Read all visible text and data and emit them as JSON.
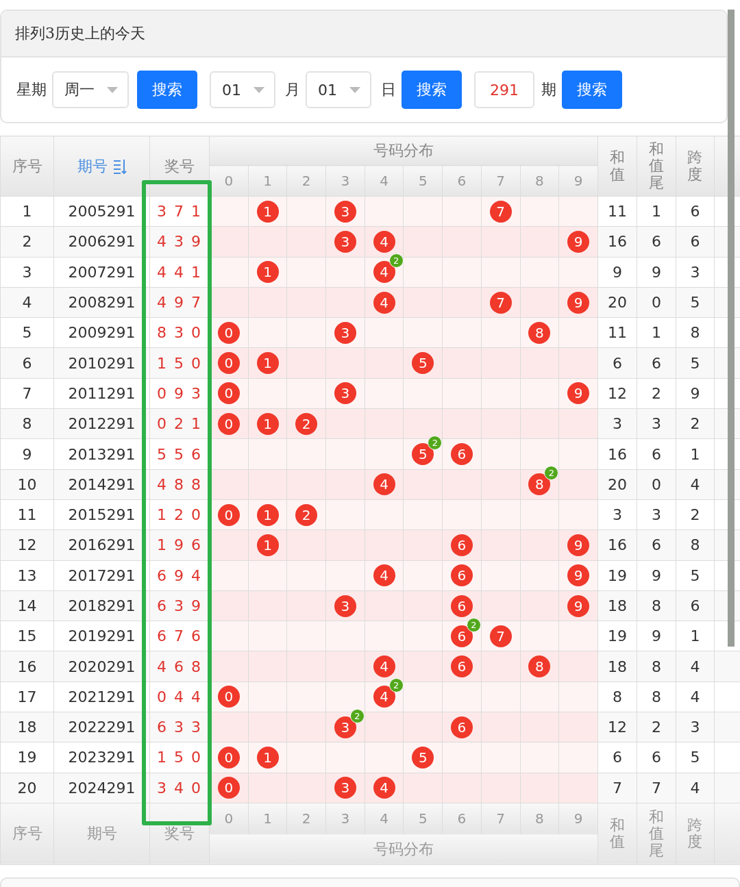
{
  "panel": {
    "title": "排列3历史上的今天",
    "controls": [
      {
        "kind": "label",
        "text": "星期"
      },
      {
        "kind": "select",
        "value": "周一"
      },
      {
        "kind": "button",
        "text": "搜索"
      },
      {
        "kind": "select",
        "value": "01"
      },
      {
        "kind": "label",
        "text": "月"
      },
      {
        "kind": "select",
        "value": "01"
      },
      {
        "kind": "label",
        "text": "日"
      },
      {
        "kind": "button",
        "text": "搜索"
      },
      {
        "kind": "input",
        "value": "291"
      },
      {
        "kind": "label",
        "text": "期"
      },
      {
        "kind": "button",
        "text": "搜索"
      }
    ]
  },
  "table": {
    "header": {
      "index": "序号",
      "issue": "期号",
      "number": "奖号",
      "distribution": "号码分布",
      "digits": [
        "0",
        "1",
        "2",
        "3",
        "4",
        "5",
        "6",
        "7",
        "8",
        "9"
      ],
      "sum": "和值",
      "sum_tail": "和值尾",
      "span": "跨度"
    },
    "highlight": {
      "kind": "number-column"
    },
    "rows": [
      {
        "index": "1",
        "issue": "2005291",
        "number": "3 7 1",
        "cells": [
          null,
          {
            "ball": "1"
          },
          null,
          {
            "ball": "3"
          },
          null,
          null,
          null,
          {
            "ball": "7"
          },
          null,
          null
        ],
        "sum": "11",
        "sum_tail": "1",
        "span": "6"
      },
      {
        "index": "2",
        "issue": "2006291",
        "number": "4 3 9",
        "cells": [
          null,
          null,
          null,
          {
            "ball": "3"
          },
          {
            "ball": "4"
          },
          null,
          null,
          null,
          null,
          {
            "ball": "9"
          }
        ],
        "sum": "16",
        "sum_tail": "6",
        "span": "6"
      },
      {
        "index": "3",
        "issue": "2007291",
        "number": "4 4 1",
        "cells": [
          null,
          {
            "ball": "1"
          },
          null,
          null,
          {
            "ball": "4",
            "repeat": "2"
          },
          null,
          null,
          null,
          null,
          null
        ],
        "sum": "9",
        "sum_tail": "9",
        "span": "3"
      },
      {
        "index": "4",
        "issue": "2008291",
        "number": "4 9 7",
        "cells": [
          null,
          null,
          null,
          null,
          {
            "ball": "4"
          },
          null,
          null,
          {
            "ball": "7"
          },
          null,
          {
            "ball": "9"
          }
        ],
        "sum": "20",
        "sum_tail": "0",
        "span": "5"
      },
      {
        "index": "5",
        "issue": "2009291",
        "number": "8 3 0",
        "cells": [
          {
            "ball": "0"
          },
          null,
          null,
          {
            "ball": "3"
          },
          null,
          null,
          null,
          null,
          {
            "ball": "8"
          },
          null
        ],
        "sum": "11",
        "sum_tail": "1",
        "span": "8"
      },
      {
        "index": "6",
        "issue": "2010291",
        "number": "1 5 0",
        "cells": [
          {
            "ball": "0"
          },
          {
            "ball": "1"
          },
          null,
          null,
          null,
          {
            "ball": "5"
          },
          null,
          null,
          null,
          null
        ],
        "sum": "6",
        "sum_tail": "6",
        "span": "5"
      },
      {
        "index": "7",
        "issue": "2011291",
        "number": "0 9 3",
        "cells": [
          {
            "ball": "0"
          },
          null,
          null,
          {
            "ball": "3"
          },
          null,
          null,
          null,
          null,
          null,
          {
            "ball": "9"
          }
        ],
        "sum": "12",
        "sum_tail": "2",
        "span": "9"
      },
      {
        "index": "8",
        "issue": "2012291",
        "number": "0 2 1",
        "cells": [
          {
            "ball": "0"
          },
          {
            "ball": "1"
          },
          {
            "ball": "2"
          },
          null,
          null,
          null,
          null,
          null,
          null,
          null
        ],
        "sum": "3",
        "sum_tail": "3",
        "span": "2"
      },
      {
        "index": "9",
        "issue": "2013291",
        "number": "5 5 6",
        "cells": [
          null,
          null,
          null,
          null,
          null,
          {
            "ball": "5",
            "repeat": "2"
          },
          {
            "ball": "6"
          },
          null,
          null,
          null
        ],
        "sum": "16",
        "sum_tail": "6",
        "span": "1"
      },
      {
        "index": "10",
        "issue": "2014291",
        "number": "4 8 8",
        "cells": [
          null,
          null,
          null,
          null,
          {
            "ball": "4"
          },
          null,
          null,
          null,
          {
            "ball": "8",
            "repeat": "2"
          },
          null
        ],
        "sum": "20",
        "sum_tail": "0",
        "span": "4"
      },
      {
        "index": "11",
        "issue": "2015291",
        "number": "1 2 0",
        "cells": [
          {
            "ball": "0"
          },
          {
            "ball": "1"
          },
          {
            "ball": "2"
          },
          null,
          null,
          null,
          null,
          null,
          null,
          null
        ],
        "sum": "3",
        "sum_tail": "3",
        "span": "2"
      },
      {
        "index": "12",
        "issue": "2016291",
        "number": "1 9 6",
        "cells": [
          null,
          {
            "ball": "1"
          },
          null,
          null,
          null,
          null,
          {
            "ball": "6"
          },
          null,
          null,
          {
            "ball": "9"
          }
        ],
        "sum": "16",
        "sum_tail": "6",
        "span": "8"
      },
      {
        "index": "13",
        "issue": "2017291",
        "number": "6 9 4",
        "cells": [
          null,
          null,
          null,
          null,
          {
            "ball": "4"
          },
          null,
          {
            "ball": "6"
          },
          null,
          null,
          {
            "ball": "9"
          }
        ],
        "sum": "19",
        "sum_tail": "9",
        "span": "5"
      },
      {
        "index": "14",
        "issue": "2018291",
        "number": "6 3 9",
        "cells": [
          null,
          null,
          null,
          {
            "ball": "3"
          },
          null,
          null,
          {
            "ball": "6"
          },
          null,
          null,
          {
            "ball": "9"
          }
        ],
        "sum": "18",
        "sum_tail": "8",
        "span": "6"
      },
      {
        "index": "15",
        "issue": "2019291",
        "number": "6 7 6",
        "cells": [
          null,
          null,
          null,
          null,
          null,
          null,
          {
            "ball": "6",
            "repeat": "2"
          },
          {
            "ball": "7"
          },
          null,
          null
        ],
        "sum": "19",
        "sum_tail": "9",
        "span": "1"
      },
      {
        "index": "16",
        "issue": "2020291",
        "number": "4 6 8",
        "cells": [
          null,
          null,
          null,
          null,
          {
            "ball": "4"
          },
          null,
          {
            "ball": "6"
          },
          null,
          {
            "ball": "8"
          },
          null
        ],
        "sum": "18",
        "sum_tail": "8",
        "span": "4"
      },
      {
        "index": "17",
        "issue": "2021291",
        "number": "0 4 4",
        "cells": [
          {
            "ball": "0"
          },
          null,
          null,
          null,
          {
            "ball": "4",
            "repeat": "2"
          },
          null,
          null,
          null,
          null,
          null
        ],
        "sum": "8",
        "sum_tail": "8",
        "span": "4"
      },
      {
        "index": "18",
        "issue": "2022291",
        "number": "6 3 3",
        "cells": [
          null,
          null,
          null,
          {
            "ball": "3",
            "repeat": "2"
          },
          null,
          null,
          {
            "ball": "6"
          },
          null,
          null,
          null
        ],
        "sum": "12",
        "sum_tail": "2",
        "span": "3"
      },
      {
        "index": "19",
        "issue": "2023291",
        "number": "1 5 0",
        "cells": [
          {
            "ball": "0"
          },
          {
            "ball": "1"
          },
          null,
          null,
          null,
          {
            "ball": "5"
          },
          null,
          null,
          null,
          null
        ],
        "sum": "6",
        "sum_tail": "6",
        "span": "5"
      },
      {
        "index": "20",
        "issue": "2024291",
        "number": "3 4 0",
        "cells": [
          {
            "ball": "0"
          },
          null,
          null,
          {
            "ball": "3"
          },
          {
            "ball": "4"
          },
          null,
          null,
          null,
          null,
          null
        ],
        "sum": "7",
        "sum_tail": "7",
        "span": "4"
      }
    ],
    "footer": {
      "index": "序号",
      "issue": "期号",
      "number": "奖号",
      "distribution": "号码分布",
      "digits": [
        "0",
        "1",
        "2",
        "3",
        "4",
        "5",
        "6",
        "7",
        "8",
        "9"
      ],
      "sum": "和值",
      "sum_tail": "和值尾",
      "span": "跨度"
    }
  }
}
